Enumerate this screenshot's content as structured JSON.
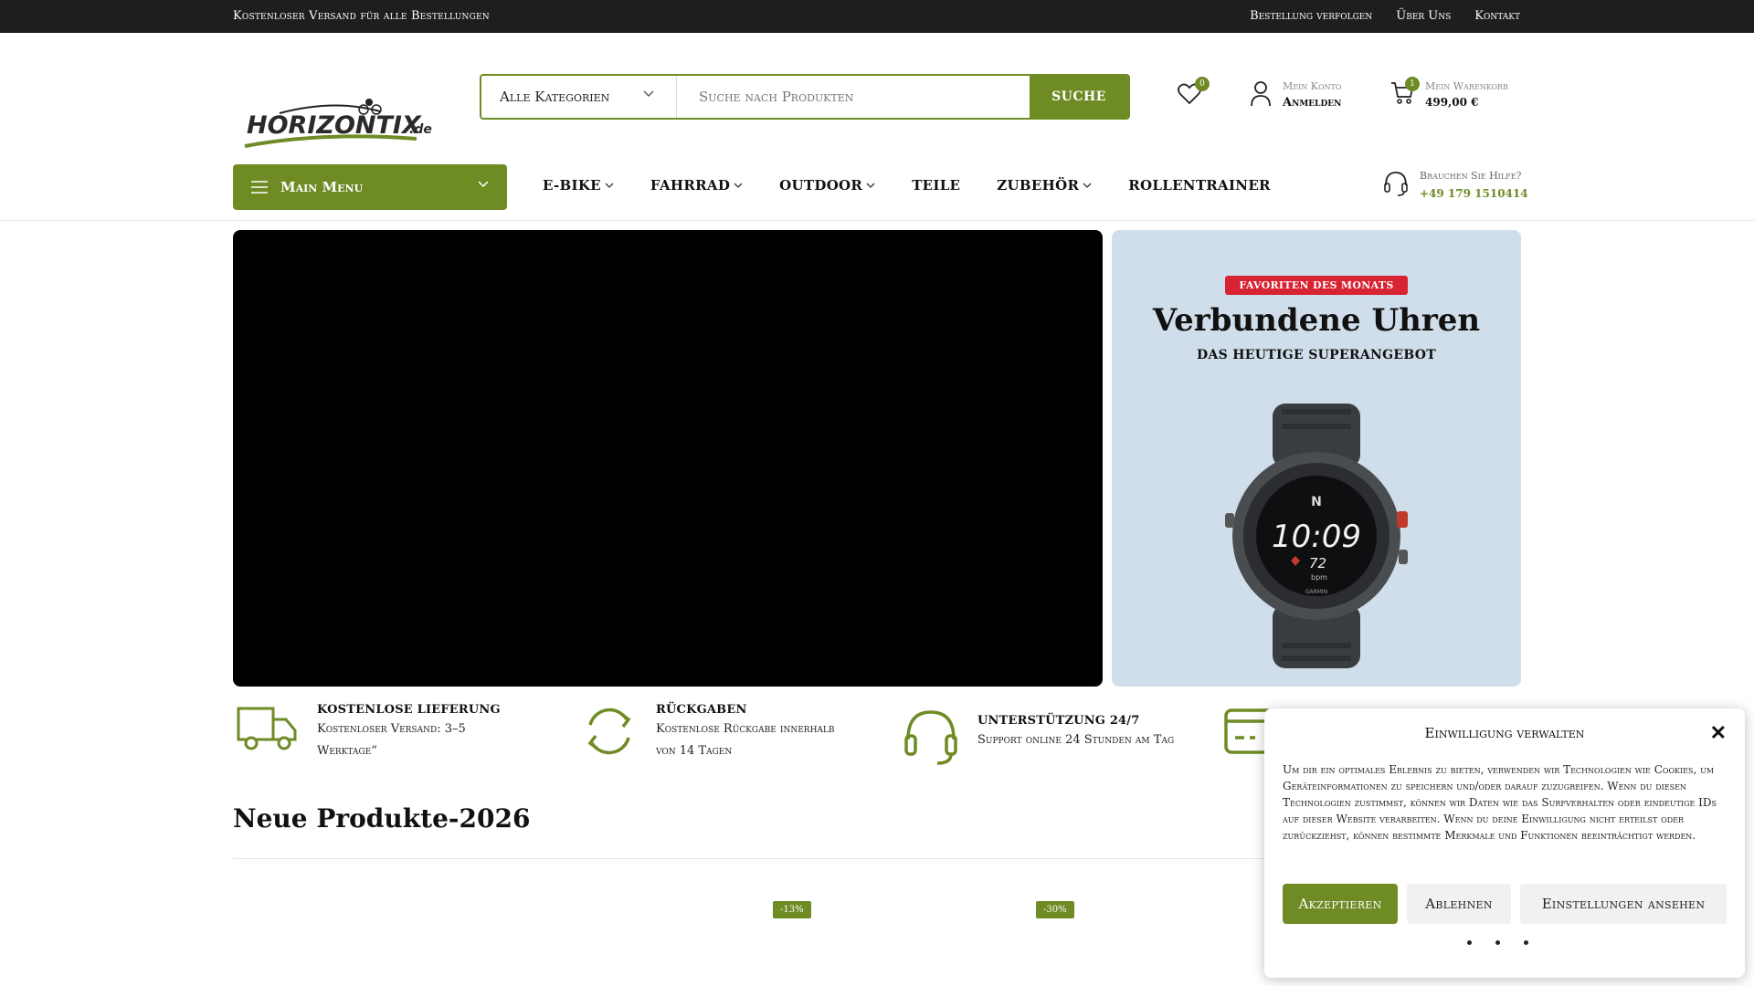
{
  "topbar": {
    "shipping": "Kostenloser Versand für alle Bestellungen",
    "links": [
      "Bestellung verfolgen",
      "Über Uns",
      "Kontakt"
    ]
  },
  "logo": {
    "main": "HORIZONTIX",
    "suffix": ".de"
  },
  "search": {
    "category": "Alle Kategorien",
    "placeholder": "Suche nach Produkten",
    "button": "SUCHE"
  },
  "header": {
    "wishlist_count": "0",
    "account_small": "Mein Konto",
    "account_large": "Anmelden",
    "cart_count": "1",
    "cart_small": "Mein Warenkorb",
    "cart_total": "499,00 €"
  },
  "nav": {
    "main_menu": "Main Menu",
    "items": [
      "E-BIKE",
      "FAHRRAD",
      "OUTDOOR",
      "TEILE",
      "ZUBEHÖR",
      "ROLLENTRAINER"
    ],
    "help_label": "Brauchen Sie Hilfe?",
    "help_phone": "+49 179 1510414"
  },
  "promo": {
    "tag": "FAVORITEN DES MONATS",
    "title": "Verbundene Uhren",
    "subtitle": "DAS HEUTIGE SUPERANGEBOT",
    "watch_time": "10:09",
    "watch_bpm": "72",
    "watch_bpm_unit": "bpm",
    "watch_compass": "N",
    "watch_brand": "GARMIN"
  },
  "features": [
    {
      "title": "KOSTENLOSE LIEFERUNG",
      "desc1": "Kostenloser Versand: 3–5",
      "desc2": "Werktage“"
    },
    {
      "title": "RÜCKGABEN",
      "desc1": "Kostenlose Rückgabe innerhalb",
      "desc2": "von 14 Tagen"
    },
    {
      "title": "UNTERSTÜTZUNG 24/7",
      "desc1": "Support online 24 Stunden am Tag",
      "desc2": ""
    }
  ],
  "products": {
    "heading": "Neue Produkte-2026",
    "discounts": [
      "-13%",
      "-30%"
    ]
  },
  "cookie": {
    "title": "Einwilligung verwalten",
    "close": "✕",
    "body": "Um dir ein optimales Erlebnis zu bieten, verwenden wir Technologien wie Cookies, um Geräteinformationen zu speichern und/oder darauf zuzugreifen. Wenn du diesen Technologien zustimmst, können wir Daten wie das Surfverhalten oder eindeutige IDs auf dieser Website verarbeiten. Wenn du deine Einwilligung nicht erteilst oder zurückziehst, können bestimmte Merkmale und Funktionen beeinträchtigt werden.",
    "accept": "Akzeptieren",
    "deny": "Ablehnen",
    "settings": "Einstellungen ansehen"
  },
  "colors": {
    "brand_green": "#6e8b24",
    "topbar": "#1e1e1e",
    "promo_bg": "#cfdeea",
    "tag_red": "#d82332"
  }
}
